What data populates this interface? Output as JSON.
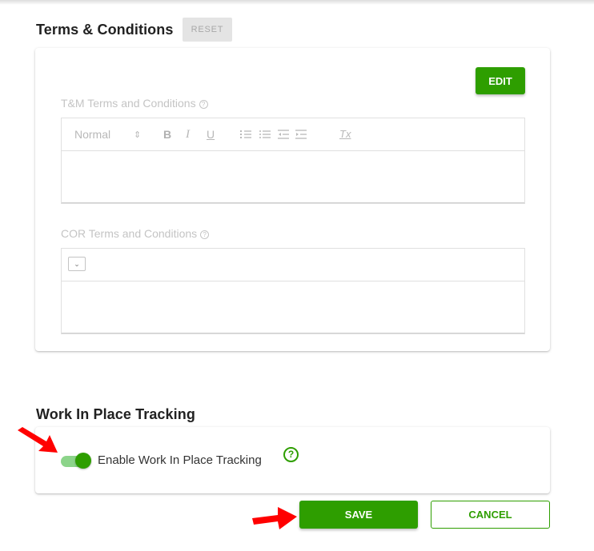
{
  "terms": {
    "title": "Terms & Conditions",
    "reset_label": "RESET",
    "edit_label": "EDIT",
    "tm_label": "T&M Terms and Conditions",
    "cor_label": "COR Terms and Conditions",
    "help_glyph": "?",
    "toolbar": {
      "format_select": "Normal",
      "select_arrows": "⇕",
      "bold": "B",
      "italic": "I",
      "underline": "U",
      "clear_format": "Tx"
    },
    "cor_toolbar_select": "⌄"
  },
  "wip": {
    "title": "Work In Place Tracking",
    "toggle_label": "Enable Work In Place Tracking",
    "toggle_on": true,
    "help_glyph": "?"
  },
  "actions": {
    "save_label": "SAVE",
    "cancel_label": "CANCEL"
  },
  "colors": {
    "accent": "#2e9e00",
    "toggle_track": "#8cd48a",
    "annotation_arrow": "#ff0000"
  }
}
